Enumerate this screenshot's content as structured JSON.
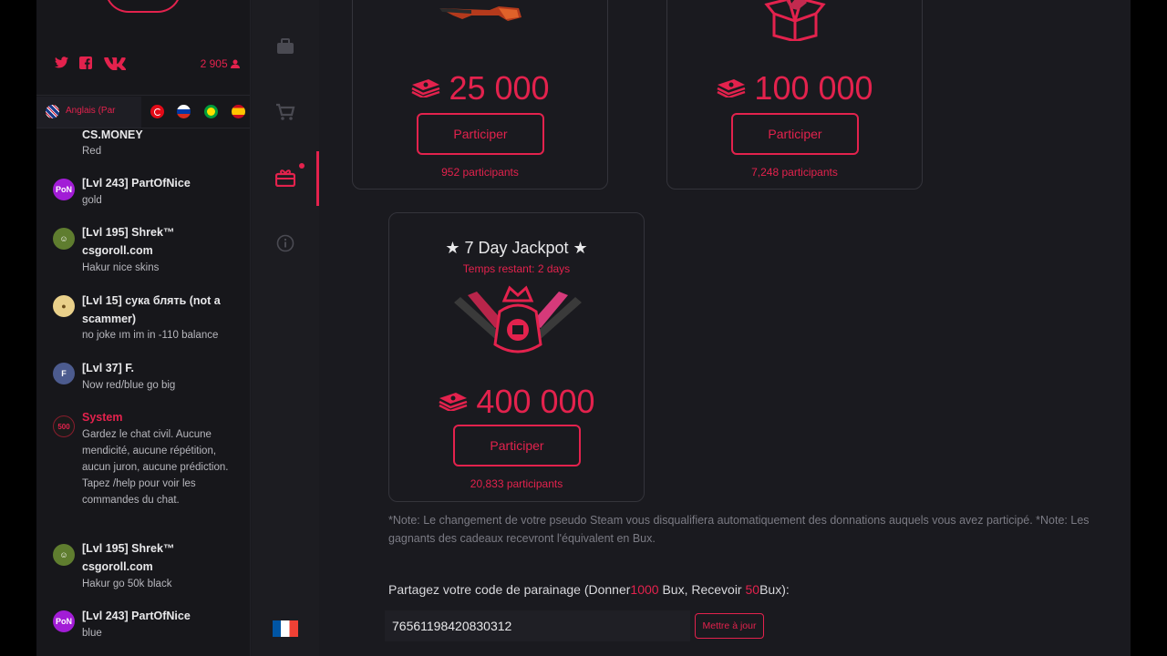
{
  "social": {
    "icons": [
      "twitter-icon",
      "facebook-icon",
      "vk-icon"
    ],
    "online_count": "2 905"
  },
  "language": {
    "current_label": "Anglais (Par",
    "flags": [
      "turkey",
      "russia",
      "brazil",
      "spain"
    ]
  },
  "chat": {
    "partial_top": {
      "name": "CS.MONEY",
      "text": "Red"
    },
    "messages": [
      {
        "name": "[Lvl 243] PartOfNice",
        "text": "gold",
        "avatar": "PoN"
      },
      {
        "name": "[Lvl 195] Shrek™ csgoroll.com",
        "text": "Hakur nice skins",
        "avatar": "shrek"
      },
      {
        "name": "[Lvl 15] сука блять (not a scammer)",
        "text": "no joke ım im in -110 balance",
        "avatar": "doge"
      },
      {
        "name": "[Lvl 37] F.",
        "text": "Now red/blue go big",
        "avatar": "f"
      },
      {
        "name": "System",
        "text": "Gardez le chat civil. Aucune mendicité, aucune répétition, aucun juron, aucune prédiction. Tapez /help pour voir les commandes du chat.",
        "avatar": "500"
      },
      {
        "name": "[Lvl 195] Shrek™ csgoroll.com",
        "text": "Hakur go 50k black",
        "avatar": "shrek"
      },
      {
        "name": "[Lvl 243] PartOfNice",
        "text": "blue",
        "avatar": "PoN"
      }
    ]
  },
  "nav": {
    "items": [
      "briefcase-icon",
      "cart-icon",
      "gift-icon",
      "info-icon"
    ],
    "language_flag": "france"
  },
  "giveaways": [
    {
      "amount": "25 000",
      "button": "Participer",
      "participants": "952 participants"
    },
    {
      "amount": "100 000",
      "button": "Participer",
      "participants": "7,248 participants"
    },
    {
      "title": "★ 7 Day Jackpot ★",
      "time_left": "Temps restant: 2 days",
      "amount": "400 000",
      "button": "Participer",
      "participants": "20,833 participants"
    }
  ],
  "note": "*Note: Le changement de votre pseudo Steam vous disqualifiera automatiquement des donnations auquels vous avez participé. *Note: Les gagnants des cadeaux recevront l'équivalent en Bux.",
  "referral": {
    "label_part1": "Partagez votre code de parainage (Donner",
    "give_amount": "1000",
    "label_part2": " Bux, Recevoir ",
    "receive_amount": "50",
    "label_part3": "Bux):",
    "code": "76561198420830312",
    "update_button": "Mettre à jour"
  },
  "colors": {
    "accent": "#e3224d",
    "background": "#1a1a1f",
    "panel": "#17171b"
  }
}
